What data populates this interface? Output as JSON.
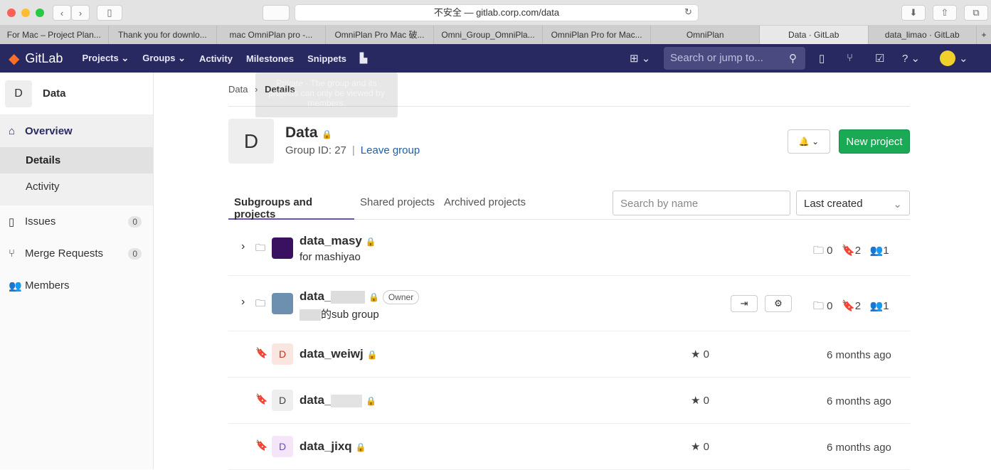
{
  "browser": {
    "url": "不安全 — gitlab.corp.com/data",
    "tabs": [
      "For Mac – Project Plan...",
      "Thank you for downlo...",
      "mac OmniPlan pro -...",
      "OmniPlan Pro Mac 破...",
      "Omni_Group_OmniPla...",
      "OmniPlan Pro for Mac...",
      "OmniPlan",
      "Data · GitLab",
      "data_limao · GitLab"
    ],
    "active_tab": 7
  },
  "nav": {
    "brand": "GitLab",
    "items": [
      "Projects ⌄",
      "Groups ⌄",
      "Activity",
      "Milestones",
      "Snippets"
    ],
    "search_placeholder": "Search or jump to..."
  },
  "sidebar": {
    "group_initial": "D",
    "group_name": "Data",
    "items": [
      {
        "label": "Overview"
      },
      {
        "label": "Details"
      },
      {
        "label": "Activity"
      },
      {
        "label": "Issues",
        "count": "0"
      },
      {
        "label": "Merge Requests",
        "count": "0"
      },
      {
        "label": "Members"
      }
    ]
  },
  "breadcrumb": {
    "parent": "Data",
    "current": "Details"
  },
  "tooltip": "Private - The group and its projects can only be viewed by members.",
  "group": {
    "initial": "D",
    "name": "Data",
    "id_label": "Group ID: 27",
    "leave": "Leave group",
    "new_project": "New project"
  },
  "tabs": [
    "Subgroups and projects",
    "Shared projects",
    "Archived projects"
  ],
  "filter": {
    "search_placeholder": "Search by name",
    "sort": "Last created"
  },
  "subgroups": [
    {
      "name": "data_masy",
      "desc": "for mashiyao",
      "subgroups": "0",
      "projects": "2",
      "members": "1",
      "color": "#3a1060"
    },
    {
      "name": "data_",
      "desc": "的sub group",
      "badge": "Owner",
      "subgroups": "0",
      "projects": "2",
      "members": "1",
      "color": "#6d8fb0"
    }
  ],
  "projects": [
    {
      "initial": "D",
      "name": "data_weiwj",
      "stars": "0",
      "updated": "6 months ago",
      "bg": "#fbe5e1",
      "fg": "#c0341d"
    },
    {
      "initial": "D",
      "name": "data_",
      "stars": "0",
      "updated": "6 months ago",
      "bg": "#eee",
      "fg": "#444"
    },
    {
      "initial": "D",
      "name": "data_jixq",
      "stars": "0",
      "updated": "6 months ago",
      "bg": "#f4e6f8",
      "fg": "#6b4fbb"
    }
  ]
}
